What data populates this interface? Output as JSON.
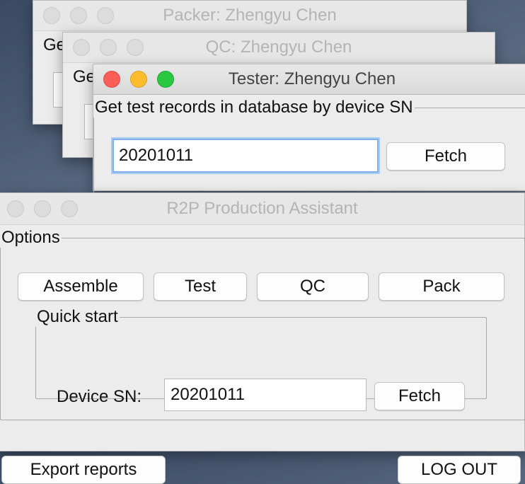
{
  "packer_window": {
    "title": "Packer: Zhengyu Chen",
    "group_label_partial": "Ge"
  },
  "qc_window": {
    "title": "QC: Zhengyu Chen",
    "group_label_partial": "Ge"
  },
  "tester_window": {
    "title": "Tester: Zhengyu Chen",
    "group_label": "Get test records in database by device SN",
    "sn_value": "20201011",
    "fetch_label": "Fetch"
  },
  "main_window": {
    "title": "R2P Production Assistant",
    "options_label": "Options",
    "buttons": {
      "assemble": "Assemble",
      "test": "Test",
      "qc": "QC",
      "pack": "Pack"
    },
    "quick_start": {
      "label": "Quick start",
      "device_sn_label": "Device SN:",
      "device_sn_value": "20201011",
      "fetch_label": "Fetch"
    },
    "export_label": "Export reports",
    "logout_label": "LOG OUT"
  }
}
